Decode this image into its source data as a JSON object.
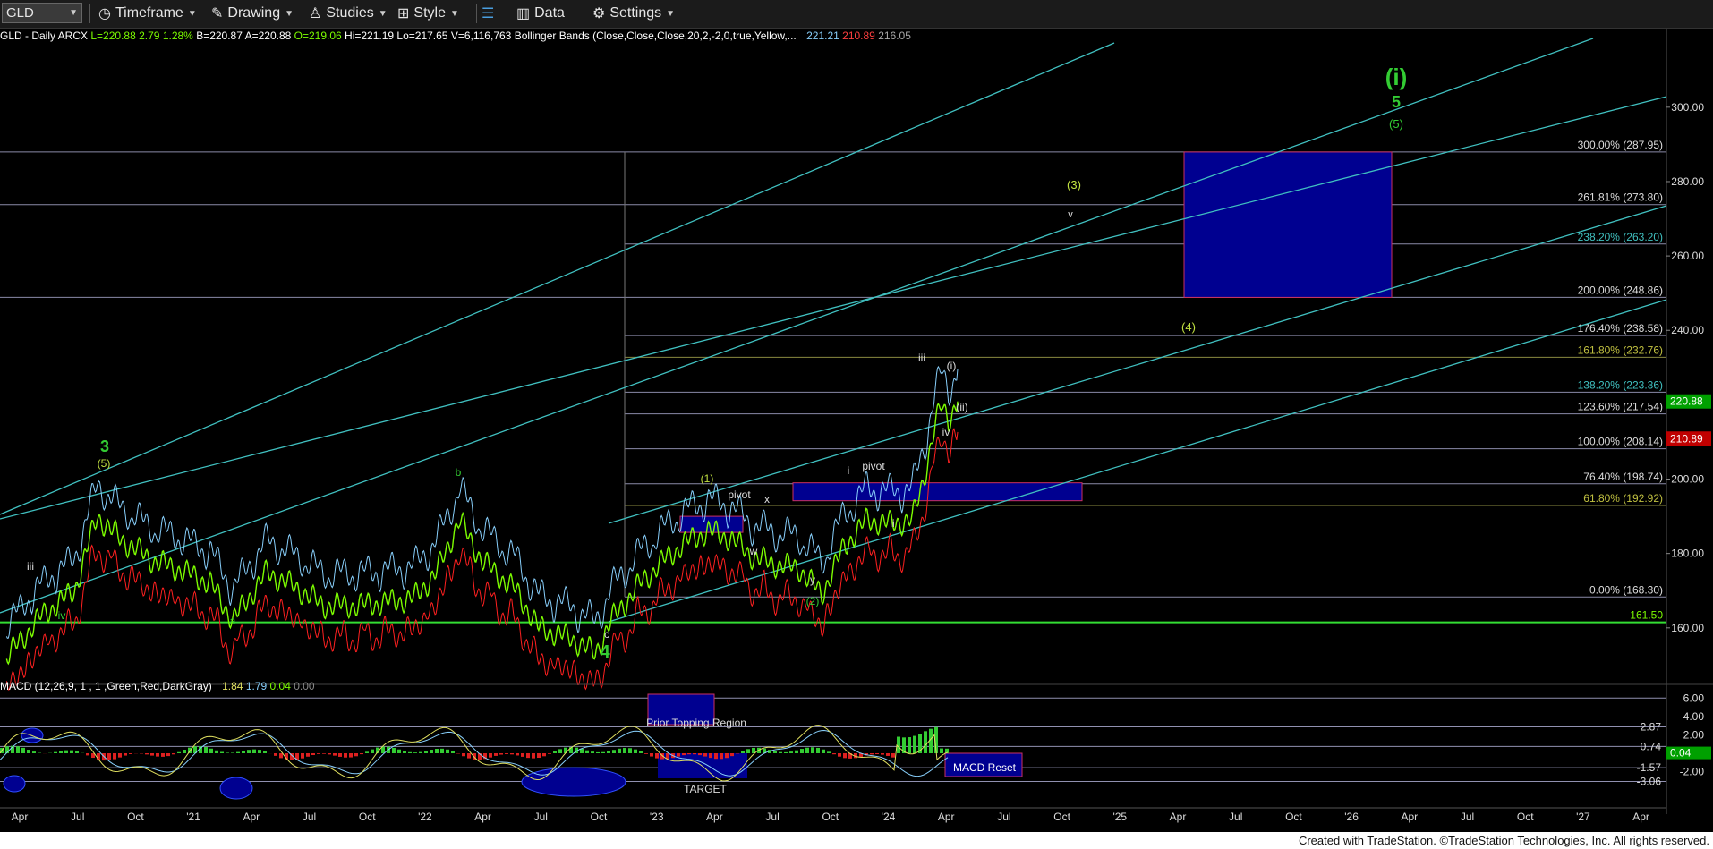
{
  "toolbar": {
    "symbol": "GLD",
    "timeframe": "Timeframe",
    "drawing": "Drawing",
    "studies": "Studies",
    "style": "Style",
    "data": "Data",
    "settings": "Settings"
  },
  "info": {
    "title": "GLD - Daily ARCX",
    "last": "L=220.88",
    "chg": "2.79",
    "pct": "1.28%",
    "bid": "B=220.87",
    "ask": "A=220.88",
    "open": "O=219.06",
    "high": "Hi=221.19",
    "low": "Lo=217.65",
    "vol": "V=6,116,763",
    "bb": "Bollinger Bands (Close,Close,Close,20,2,-2,0,true,Yellow,...",
    "bb_up": "221.21",
    "bb_dn": "210.89",
    "bb_mid": "216.05"
  },
  "macd_info": {
    "label": "MACD (12,26,9, 1 , 1 ,Green,Red,DarkGray)",
    "v1": "1.84",
    "v2": "1.79",
    "v3": "0.04",
    "v4": "0.00"
  },
  "credit": "Created with TradeStation. ©TradeStation Technologies, Inc. All rights reserved.",
  "colors": {
    "price": "#7CFC00",
    "bb_upper": "#87CEFA",
    "bb_lower": "#FF2020",
    "channel": "#40C0C0",
    "fib": "#9090B0",
    "box": "#000090",
    "wave": "#33CC33"
  },
  "chart_data": {
    "type": "line",
    "symbol": "GLD",
    "price_axis": {
      "ticks": [
        160,
        180,
        200,
        220,
        240,
        260,
        280,
        300
      ],
      "tick_labels": [
        "160.00",
        "180.00",
        "200.00",
        "",
        "240.00",
        "260.00",
        "280.00",
        "300.00"
      ],
      "range": [
        146,
        318
      ]
    },
    "macd_axis": {
      "tick_labels": [
        "6.00",
        "4.00",
        "2.00",
        "-2.00"
      ],
      "range": [
        -3.5,
        7
      ]
    },
    "time_axis": {
      "labels": [
        "Apr",
        "Jul",
        "Oct",
        "'21",
        "Apr",
        "Jul",
        "Oct",
        "'22",
        "Apr",
        "Jul",
        "Oct",
        "'23",
        "Apr",
        "Jul",
        "Oct",
        "'24",
        "Apr",
        "Jul",
        "Oct",
        "'25",
        "Apr",
        "Jul",
        "Oct",
        "'26",
        "Apr",
        "Jul",
        "Oct",
        "'27",
        "Apr"
      ]
    },
    "series": [
      {
        "name": "GLD",
        "points": [
          [
            2020.2,
            152
          ],
          [
            2020.35,
            163
          ],
          [
            2020.5,
            170
          ],
          [
            2020.6,
            190
          ],
          [
            2020.7,
            184
          ],
          [
            2020.85,
            178
          ],
          [
            2020.95,
            176
          ],
          [
            2021.1,
            172
          ],
          [
            2021.2,
            162
          ],
          [
            2021.35,
            175
          ],
          [
            2021.5,
            170
          ],
          [
            2021.6,
            166
          ],
          [
            2021.75,
            166
          ],
          [
            2021.9,
            167
          ],
          [
            2022.0,
            168
          ],
          [
            2022.1,
            175
          ],
          [
            2022.2,
            189
          ],
          [
            2022.3,
            178
          ],
          [
            2022.45,
            170
          ],
          [
            2022.55,
            160
          ],
          [
            2022.7,
            157
          ],
          [
            2022.8,
            153
          ],
          [
            2022.87,
            162
          ],
          [
            2023.0,
            172
          ],
          [
            2023.1,
            178
          ],
          [
            2023.2,
            183
          ],
          [
            2023.3,
            186
          ],
          [
            2023.4,
            184
          ],
          [
            2023.5,
            179
          ],
          [
            2023.6,
            177
          ],
          [
            2023.7,
            176
          ],
          [
            2023.8,
            169
          ],
          [
            2023.9,
            182
          ],
          [
            2024.0,
            189
          ],
          [
            2024.1,
            188
          ],
          [
            2024.2,
            189
          ],
          [
            2024.25,
            200
          ],
          [
            2024.3,
            214
          ],
          [
            2024.33,
            220
          ],
          [
            2024.36,
            216
          ],
          [
            2024.4,
            220.88
          ]
        ]
      }
    ],
    "fib_levels": [
      {
        "label": "300.00% (287.95)",
        "value": 287.95
      },
      {
        "label": "261.81% (273.80)",
        "value": 273.8
      },
      {
        "label": "238.20% (263.20)",
        "value": 263.2
      },
      {
        "label": "200.00% (248.86)",
        "value": 248.86
      },
      {
        "label": "176.40% (238.58)",
        "value": 238.58
      },
      {
        "label": "161.80% (232.76)",
        "value": 232.76
      },
      {
        "label": "138.20% (223.36)",
        "value": 223.36
      },
      {
        "label": "123.60% (217.54)",
        "value": 217.54
      },
      {
        "label": "100.00% (208.14)",
        "value": 208.14
      },
      {
        "label": "76.40% (198.74)",
        "value": 198.74
      },
      {
        "label": "61.80% (192.92)",
        "value": 192.92
      },
      {
        "label": "0.00% (168.30)",
        "value": 168.3
      }
    ],
    "support_level": {
      "label": "161.50",
      "value": 161.5
    },
    "price_badges": {
      "last": "220.88",
      "lower": "210.89"
    },
    "macd_levels": {
      "upper": "2.87",
      "mid": "0.74",
      "low": "-1.57",
      "bottom": "-3.06",
      "badge": "0.04"
    },
    "wave_labels": [
      "(i)",
      "5",
      "(5)",
      "(3)",
      "v",
      "(4)",
      "iii",
      "(i)",
      "(ii)",
      "iv",
      "i",
      "pivot",
      "(1)",
      "pivot",
      "x",
      "w",
      "ii",
      "y",
      "(2)",
      "3",
      "(5)",
      "b",
      "iii",
      "iv",
      "a",
      "c",
      "4"
    ],
    "macd_annotations": {
      "prior_topping": "Prior Topping Region",
      "target": "TARGET",
      "macd_reset": "MACD Reset"
    },
    "legend": "none",
    "grid": false
  }
}
